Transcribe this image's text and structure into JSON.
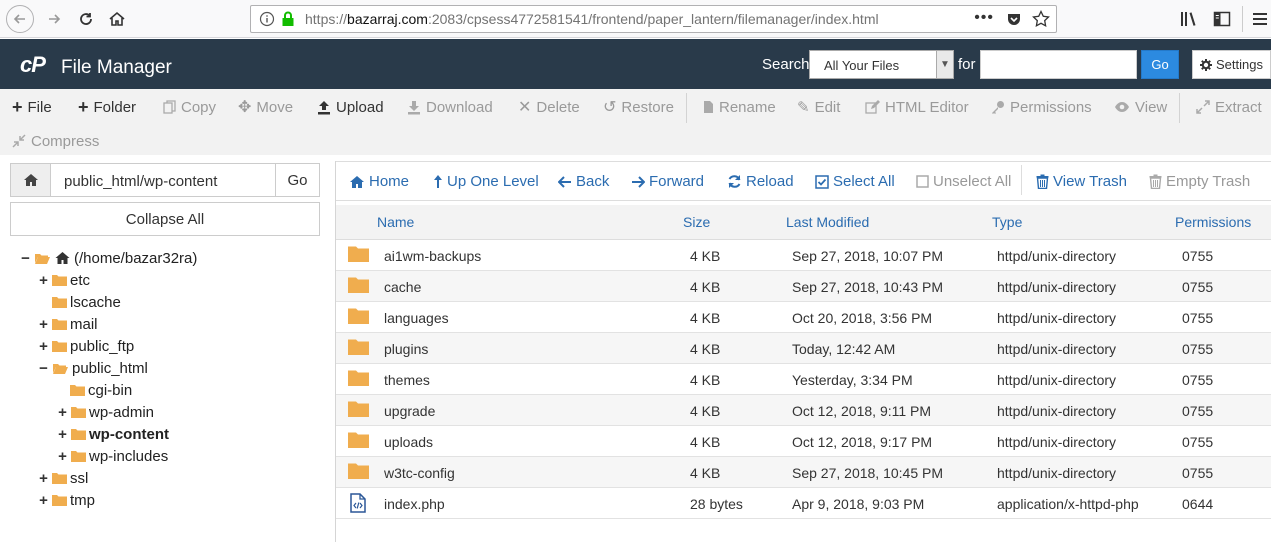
{
  "browser": {
    "url_secure_prefix": "https://",
    "url_host": "bazarraj.com",
    "url_rest": ":2083/cpsess4772581541/frontend/paper_lantern/filemanager/index.html",
    "more_icon": "ellipsis-icon"
  },
  "header": {
    "logo": "cP",
    "title": "File Manager",
    "search_label": "Search",
    "search_scope": "All Your Files",
    "for_label": "for",
    "search_value": "",
    "go_label": "Go",
    "settings_label": "Settings"
  },
  "toolbar": {
    "file": "File",
    "folder": "Folder",
    "copy": "Copy",
    "move": "Move",
    "upload": "Upload",
    "download": "Download",
    "delete": "Delete",
    "restore": "Restore",
    "rename": "Rename",
    "edit": "Edit",
    "html_editor": "HTML Editor",
    "permissions": "Permissions",
    "view": "View",
    "extract": "Extract",
    "compress": "Compress"
  },
  "left_panel": {
    "path_value": "public_html/wp-content",
    "go_label": "Go",
    "collapse_label": "Collapse All",
    "tree": {
      "root": "(/home/bazar32ra)",
      "etc": "etc",
      "lscache": "lscache",
      "mail": "mail",
      "public_ftp": "public_ftp",
      "public_html": "public_html",
      "cgi_bin": "cgi-bin",
      "wp_admin": "wp-admin",
      "wp_content": "wp-content",
      "wp_includes": "wp-includes",
      "ssl": "ssl",
      "tmp": "tmp"
    }
  },
  "nav": {
    "home": "Home",
    "up_one_level": "Up One Level",
    "back": "Back",
    "forward": "Forward",
    "reload": "Reload",
    "select_all": "Select All",
    "unselect_all": "Unselect All",
    "view_trash": "View Trash",
    "empty_trash": "Empty Trash"
  },
  "table": {
    "headers": {
      "name": "Name",
      "size": "Size",
      "modified": "Last Modified",
      "type": "Type",
      "permissions": "Permissions"
    },
    "rows": [
      {
        "icon": "folder-icon",
        "name": "ai1wm-backups",
        "size": "4 KB",
        "modified": "Sep 27, 2018, 10:07 PM",
        "type": "httpd/unix-directory",
        "perm": "0755"
      },
      {
        "icon": "folder-icon",
        "name": "cache",
        "size": "4 KB",
        "modified": "Sep 27, 2018, 10:43 PM",
        "type": "httpd/unix-directory",
        "perm": "0755"
      },
      {
        "icon": "folder-icon",
        "name": "languages",
        "size": "4 KB",
        "modified": "Oct 20, 2018, 3:56 PM",
        "type": "httpd/unix-directory",
        "perm": "0755"
      },
      {
        "icon": "folder-icon",
        "name": "plugins",
        "size": "4 KB",
        "modified": "Today, 12:42 AM",
        "type": "httpd/unix-directory",
        "perm": "0755"
      },
      {
        "icon": "folder-icon",
        "name": "themes",
        "size": "4 KB",
        "modified": "Yesterday, 3:34 PM",
        "type": "httpd/unix-directory",
        "perm": "0755"
      },
      {
        "icon": "folder-icon",
        "name": "upgrade",
        "size": "4 KB",
        "modified": "Oct 12, 2018, 9:11 PM",
        "type": "httpd/unix-directory",
        "perm": "0755"
      },
      {
        "icon": "folder-icon",
        "name": "uploads",
        "size": "4 KB",
        "modified": "Oct 12, 2018, 9:17 PM",
        "type": "httpd/unix-directory",
        "perm": "0755"
      },
      {
        "icon": "folder-icon",
        "name": "w3tc-config",
        "size": "4 KB",
        "modified": "Sep 27, 2018, 10:45 PM",
        "type": "httpd/unix-directory",
        "perm": "0755"
      },
      {
        "icon": "php-file-icon",
        "name": "index.php",
        "size": "28 bytes",
        "modified": "Apr 9, 2018, 9:03 PM",
        "type": "application/x-httpd-php",
        "perm": "0644"
      }
    ]
  },
  "colors": {
    "header_bg": "#293a4a",
    "accent_blue": "#2b6cb0",
    "go_blue": "#2c8ae0",
    "folder": "#f0ad4e"
  }
}
